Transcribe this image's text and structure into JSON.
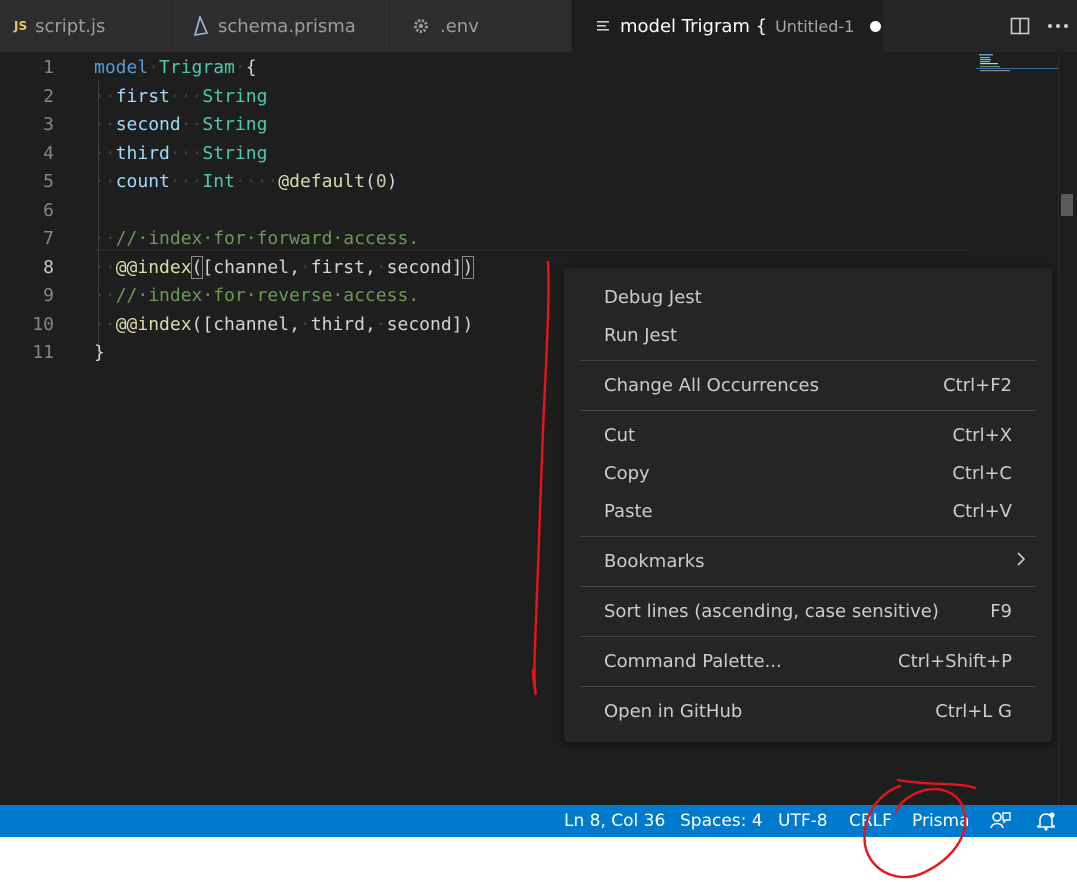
{
  "tabs": [
    {
      "label": "script.js",
      "badge": "JS",
      "icon": "javascript-icon"
    },
    {
      "label": "schema.prisma",
      "icon": "prisma-icon"
    },
    {
      "label": ".env",
      "icon": "gear-icon"
    },
    {
      "label": "model Trigram {",
      "description": "Untitled-1",
      "icon": "document-lines-icon",
      "dirty": true,
      "active": true
    }
  ],
  "tab_actions": [
    {
      "icon": "split-editor-icon"
    },
    {
      "icon": "more-actions-icon"
    }
  ],
  "editor": {
    "line_numbers": [
      "1",
      "2",
      "3",
      "4",
      "5",
      "6",
      "7",
      "8",
      "9",
      "10",
      "11"
    ],
    "current_line": "8",
    "code": [
      [
        {
          "t": "model",
          "c": "kw"
        },
        {
          "t": "·",
          "c": "ws"
        },
        {
          "t": "Trigram",
          "c": "type"
        },
        {
          "t": "·",
          "c": "ws"
        },
        {
          "t": "{",
          "c": "punc"
        }
      ],
      [
        {
          "t": "··",
          "c": "ws"
        },
        {
          "t": "first",
          "c": "field"
        },
        {
          "t": "···",
          "c": "ws"
        },
        {
          "t": "String",
          "c": "type"
        }
      ],
      [
        {
          "t": "··",
          "c": "ws"
        },
        {
          "t": "second",
          "c": "field"
        },
        {
          "t": "··",
          "c": "ws"
        },
        {
          "t": "String",
          "c": "type"
        }
      ],
      [
        {
          "t": "··",
          "c": "ws"
        },
        {
          "t": "third",
          "c": "field"
        },
        {
          "t": "···",
          "c": "ws"
        },
        {
          "t": "String",
          "c": "type"
        }
      ],
      [
        {
          "t": "··",
          "c": "ws"
        },
        {
          "t": "count",
          "c": "field"
        },
        {
          "t": "···",
          "c": "ws"
        },
        {
          "t": "Int",
          "c": "type"
        },
        {
          "t": "····",
          "c": "ws"
        },
        {
          "t": "@default",
          "c": "attr"
        },
        {
          "t": "(",
          "c": "punc"
        },
        {
          "t": "0",
          "c": "num"
        },
        {
          "t": ")",
          "c": "punc"
        }
      ],
      [],
      [
        {
          "t": "··",
          "c": "ws"
        },
        {
          "t": "//·index·for·forward·access.",
          "c": "cmt"
        }
      ],
      [
        {
          "t": "··",
          "c": "ws"
        },
        {
          "t": "@@index",
          "c": "attr"
        },
        {
          "t": "(",
          "c": "punc",
          "box": true
        },
        {
          "t": "[channel,",
          "c": "punc"
        },
        {
          "t": "·",
          "c": "ws"
        },
        {
          "t": "first,",
          "c": "punc"
        },
        {
          "t": "·",
          "c": "ws"
        },
        {
          "t": "second]",
          "c": "punc"
        },
        {
          "t": ")",
          "c": "punc",
          "box": true
        }
      ],
      [
        {
          "t": "··",
          "c": "ws"
        },
        {
          "t": "//·index·for·reverse·access.",
          "c": "cmt"
        }
      ],
      [
        {
          "t": "··",
          "c": "ws"
        },
        {
          "t": "@@index",
          "c": "attr"
        },
        {
          "t": "([channel,",
          "c": "punc"
        },
        {
          "t": "·",
          "c": "ws"
        },
        {
          "t": "third,",
          "c": "punc"
        },
        {
          "t": "·",
          "c": "ws"
        },
        {
          "t": "second])",
          "c": "punc"
        }
      ],
      [
        {
          "t": "}",
          "c": "punc"
        }
      ]
    ]
  },
  "context_menu": {
    "groups": [
      [
        {
          "label": "Debug Jest",
          "shortcut": ""
        },
        {
          "label": "Run Jest",
          "shortcut": ""
        }
      ],
      [
        {
          "label": "Change All Occurrences",
          "shortcut": "Ctrl+F2"
        }
      ],
      [
        {
          "label": "Cut",
          "shortcut": "Ctrl+X"
        },
        {
          "label": "Copy",
          "shortcut": "Ctrl+C"
        },
        {
          "label": "Paste",
          "shortcut": "Ctrl+V"
        }
      ],
      [
        {
          "label": "Bookmarks",
          "shortcut": "",
          "submenu": true
        }
      ],
      [
        {
          "label": "Sort lines (ascending, case sensitive)",
          "shortcut": "F9"
        }
      ],
      [
        {
          "label": "Command Palette...",
          "shortcut": "Ctrl+Shift+P"
        }
      ],
      [
        {
          "label": "Open in GitHub",
          "shortcut": "Ctrl+L G"
        }
      ]
    ]
  },
  "statusbar": {
    "position": "Ln 8, Col 36",
    "indent": "Spaces: 4",
    "encoding": "UTF-8",
    "eol": "CRLF",
    "language": "Prisma",
    "feedback_icon": "feedback-icon",
    "notifications_icon": "notifications-bell-icon"
  },
  "colors": {
    "editor_bg": "#1e1e1e",
    "statusbar_bg": "#007acc",
    "menu_bg": "#252526",
    "annotation": "#e8141b"
  }
}
